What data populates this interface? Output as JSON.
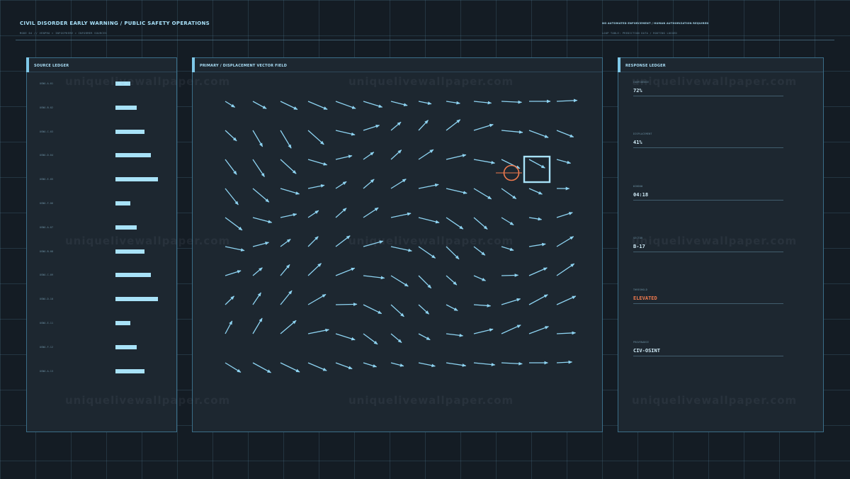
{
  "header": {
    "title": "CIVIL DISORDER EARLY WARNING / PUBLIC SAFETY OPERATIONS",
    "subtitle": "MODE 04 // VENPRO > INFOSPHERE > INFORMER SOURCES",
    "notice": "NO AUTOMATED ENFORCEMENT / HUMAN AUTHORIZATION REQUIRED",
    "notice_sub": "LOOP TABLE: PREDICTION DATA / ROUTING LOGGED"
  },
  "source_ledger": {
    "title": "SOURCE LEDGER",
    "rows": [
      {
        "label": "OSNO-A-01",
        "value": 0.35
      },
      {
        "label": "OSNO-B-02",
        "value": 0.5
      },
      {
        "label": "OSNO-C-03",
        "value": 0.68
      },
      {
        "label": "OSNO-D-04",
        "value": 0.83
      },
      {
        "label": "OSNO-E-05",
        "value": 1.0
      },
      {
        "label": "OSNO-F-06",
        "value": 0.35
      },
      {
        "label": "OSNO-A-07",
        "value": 0.5
      },
      {
        "label": "OSNO-B-08",
        "value": 0.68
      },
      {
        "label": "OSNO-C-09",
        "value": 0.83
      },
      {
        "label": "OSNO-D-10",
        "value": 1.0
      },
      {
        "label": "OSNO-E-11",
        "value": 0.35
      },
      {
        "label": "OSNO-F-12",
        "value": 0.5
      },
      {
        "label": "OSNO-A-13",
        "value": 0.68
      }
    ]
  },
  "vector_field": {
    "title": "PRIMARY / DISPLACEMENT VECTOR FIELD",
    "arrow_color": "#8ed4f2",
    "target_box_color": "#a8e2f8",
    "reticle_color": "#f07a4e"
  },
  "response_ledger": {
    "title": "RESPONSE LEDGER",
    "items": [
      {
        "label": "CONFIDENCE",
        "value": "72%",
        "alert": false
      },
      {
        "label": "DISPLACEMENT",
        "value": "41%",
        "alert": false
      },
      {
        "label": "WINDOW",
        "value": "04:18",
        "alert": false
      },
      {
        "label": "SECTOR",
        "value": "B-17",
        "alert": false
      },
      {
        "label": "THRESHOLD",
        "value": "ELEVATED",
        "alert": true
      },
      {
        "label": "PROVENANCE",
        "value": "CIV-OSINT",
        "alert": false
      }
    ]
  },
  "colors": {
    "accent": "#7fc8e8",
    "alert": "#f07a4e",
    "panel_bg": "#1d2730",
    "page_bg": "#141c24"
  },
  "watermark": "uniquelivewallpaper.com"
}
